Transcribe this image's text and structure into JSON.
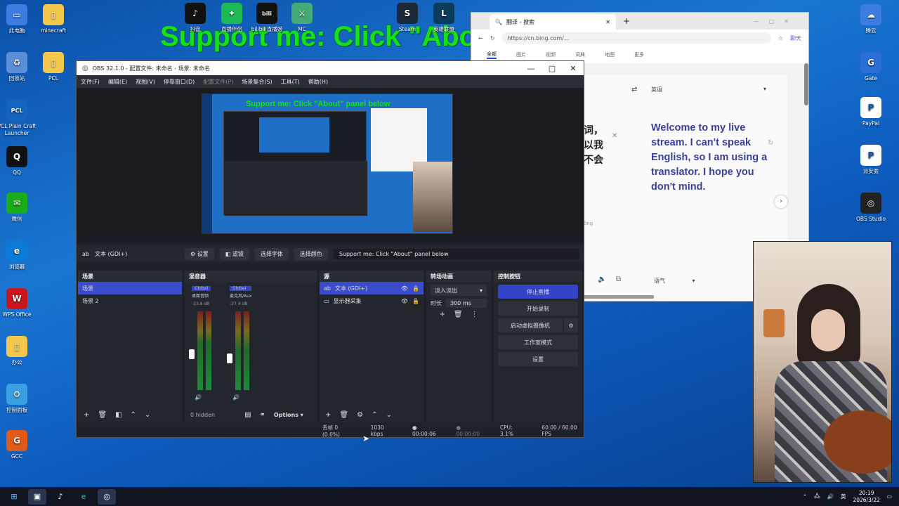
{
  "banner": "Support me: Click \"About\" panel below",
  "desktop_left": [
    {
      "label": "此电脑",
      "color": "#3d7ce0",
      "glyph": "▭"
    },
    {
      "label": "回收站",
      "color": "#5a8fd8",
      "glyph": "♻"
    },
    {
      "label": "PCL Plain Craft Launcher",
      "color": "#1565c0",
      "glyph": "PCL"
    },
    {
      "label": "QQ",
      "color": "#111",
      "glyph": "Q"
    },
    {
      "label": "微信",
      "color": "#1aad19",
      "glyph": "✉"
    },
    {
      "label": "浏览器",
      "color": "#0a7bd6",
      "glyph": "e"
    },
    {
      "label": "WPS Office",
      "color": "#c8161d",
      "glyph": "W"
    },
    {
      "label": "办公",
      "color": "#f3c74a",
      "glyph": "▯"
    },
    {
      "label": "控制面板",
      "color": "#3aa0e0",
      "glyph": "⚙"
    },
    {
      "label": "GCC",
      "color": "#e05a1a",
      "glyph": "G"
    }
  ],
  "desktop_left2": [
    {
      "label": "minecraft",
      "color": "#f3c74a",
      "glyph": "▯"
    },
    {
      "label": "PCL",
      "color": "#f3c74a",
      "glyph": "▯"
    }
  ],
  "desktop_top": [
    {
      "label": "抖音",
      "color": "#111",
      "glyph": "♪"
    },
    {
      "label": "直播伴侣",
      "color": "#1db954",
      "glyph": "✦"
    },
    {
      "label": "bilibili直播姬",
      "color": "#111",
      "glyph": "bili"
    },
    {
      "label": "MC",
      "color": "#4a7",
      "glyph": "⚔"
    },
    {
      "label": "Steam",
      "color": "#1b2838",
      "glyph": "S"
    },
    {
      "label": "英雄联盟",
      "color": "#0b3c5d",
      "glyph": "L"
    }
  ],
  "desktop_right": [
    {
      "label": "腾云",
      "color": "#3d7ce0",
      "glyph": "☁"
    },
    {
      "label": "Gate",
      "color": "#2a6fd8",
      "glyph": "G"
    },
    {
      "label": "PayPal",
      "color": "#fff",
      "glyph": "P"
    },
    {
      "label": "派安盈",
      "color": "#fff",
      "glyph": "P"
    },
    {
      "label": "OBS Studio",
      "color": "#222",
      "glyph": "◎"
    }
  ],
  "browser": {
    "tab_title": "翻译 - 搜索",
    "url": "https://cn.bing.com/...",
    "chat_label": "聊天",
    "nav": [
      "全部",
      "图片",
      "视频",
      "词典",
      "地图",
      "更多"
    ],
    "target_lang": "英语",
    "source_fragment_1": "词，",
    "source_fragment_2": "以我",
    "source_fragment_3": "不会",
    "pinyin_fragment": "ǒng",
    "translation": "Welcome to my live stream. I can't speak English, so I am using a translator. I hope you don't mind.",
    "tone_label": "语气"
  },
  "obs": {
    "title": "OBS 32.1.0 - 配置文件: 未命名 - 场景: 未命名",
    "menu": [
      "文件(F)",
      "编辑(E)",
      "视图(V)",
      "停靠窗口(D)",
      "配置文件(P)",
      "场景集合(S)",
      "工具(T)",
      "帮助(H)"
    ],
    "preview_banner": "Support me: Click \"About\" panel below",
    "selected_source": "文本 (GDI+)",
    "settings_btn": "设置",
    "filters_btn": "滤镜",
    "font_btn": "选择字体",
    "color_btn": "选择颜色",
    "text_value": "Support me: Click \"About\" panel below",
    "scenes": {
      "title": "场景",
      "items": [
        "场景",
        "场景 2"
      ]
    },
    "mixer": {
      "title": "混音器",
      "ch1": "桌面音频",
      "ch2": "麦克风/Aux",
      "db1": "-23.6 dB",
      "db2": "-27.4 dB",
      "badge": "Global",
      "hidden": "0 hidden",
      "options": "Options"
    },
    "sources": {
      "title": "源",
      "items": [
        "文本 (GDI+)",
        "显示器采集"
      ]
    },
    "transitions": {
      "title": "转场动画",
      "type": "淡入淡出",
      "duration_label": "时长",
      "duration": "300 ms"
    },
    "controls": {
      "title": "控制按钮",
      "buttons": [
        "停止直播",
        "开始录制",
        "启动虚拟摄像机",
        "工作室模式",
        "设置"
      ]
    },
    "status": {
      "dropped": "丢帧 0 (0.0%)",
      "bitrate": "1030 kbps",
      "live_time": "00:00:06",
      "rec_time": "00:00:00",
      "cpu": "CPU: 3.1%",
      "fps": "60.00 / 60.00 FPS"
    }
  },
  "taskbar": {
    "ime": "英",
    "time": "20:19",
    "date": "2026/3/22"
  }
}
